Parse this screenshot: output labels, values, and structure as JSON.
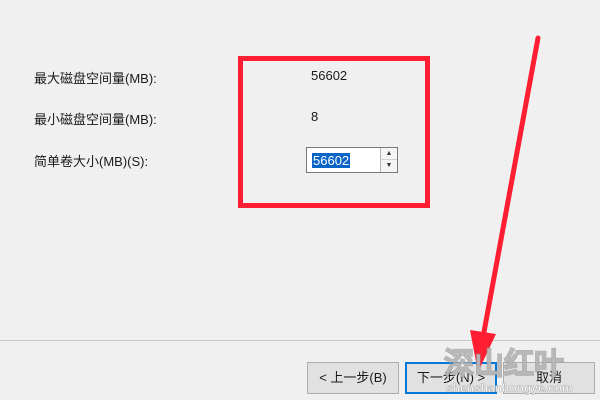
{
  "fields": {
    "max_label": "最大磁盘空间量(MB):",
    "max_value": "56602",
    "min_label": "最小磁盘空间量(MB):",
    "min_value": "8",
    "size_label": "简单卷大小(MB)(S):",
    "size_value": "56602"
  },
  "buttons": {
    "back": "< 上一步(B)",
    "next": "下一步(N) >",
    "cancel": "取消"
  },
  "annotation": {
    "highlight_color": "#ff1e32",
    "arrow_color": "#ff1e32"
  },
  "watermark": {
    "brand": "深山红叶",
    "url": "shenshanhongye.com"
  },
  "icons": {
    "spin_up": "chevron-up-icon",
    "spin_down": "chevron-down-icon",
    "arrow": "red-arrow-icon"
  }
}
